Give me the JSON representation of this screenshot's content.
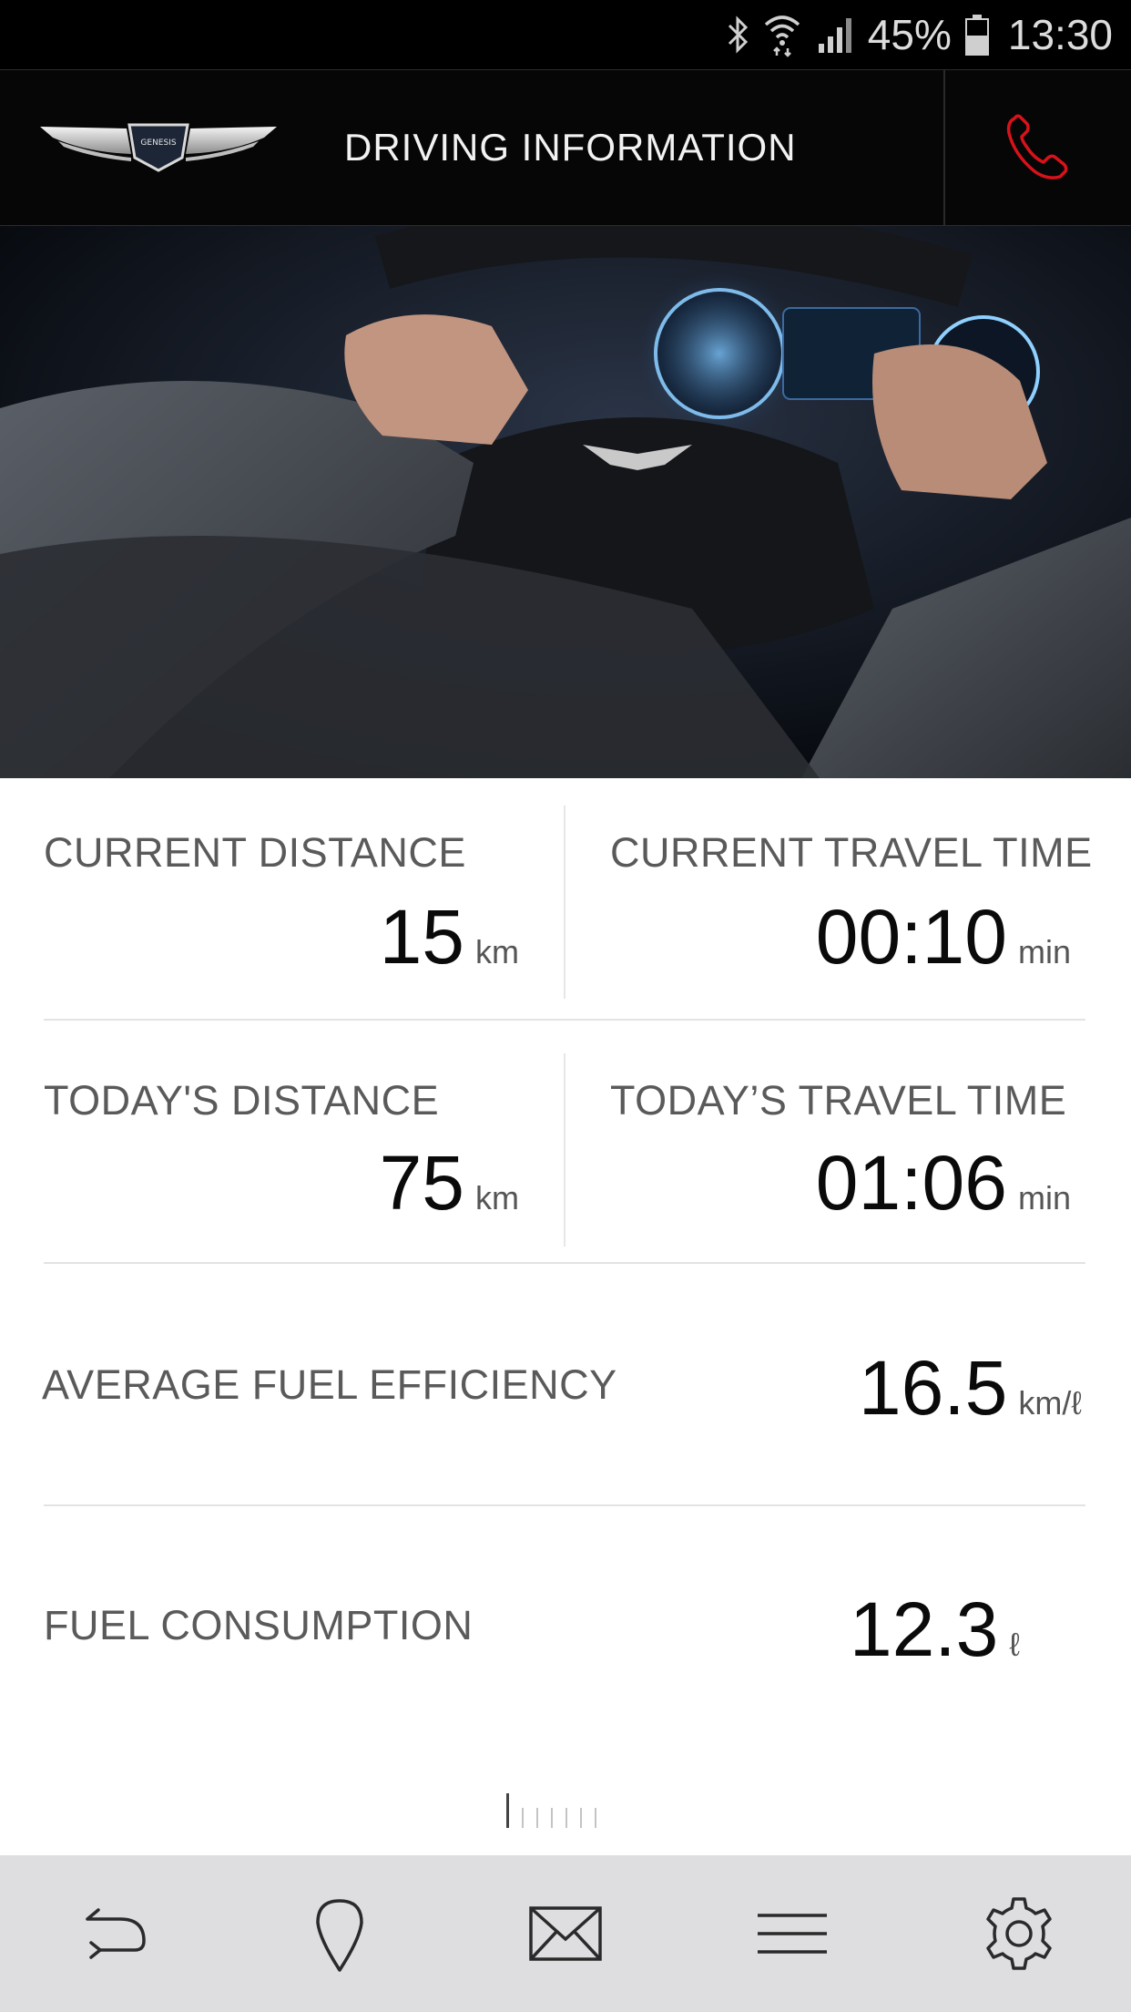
{
  "status_bar": {
    "battery_percent": "45%",
    "time": "13:30",
    "icons": [
      "bluetooth-icon",
      "wifi-icon",
      "signal-icon",
      "battery-icon"
    ]
  },
  "header": {
    "logo_text": "GENESIS",
    "title": "DRIVING INFORMATION",
    "call_icon": "phone-icon",
    "accent_color": "#d8121b"
  },
  "stats": {
    "current_distance": {
      "label": "CURRENT DISTANCE",
      "value": "15",
      "unit": "km"
    },
    "current_travel_time": {
      "label": "CURRENT TRAVEL TIME",
      "value": "00:10",
      "unit": "min"
    },
    "todays_distance": {
      "label": "TODAY'S DISTANCE",
      "value": "75",
      "unit": "km"
    },
    "todays_travel_time": {
      "label": "TODAY’S TRAVEL TIME",
      "value": "01:06",
      "unit": "min"
    },
    "average_fuel_efficiency": {
      "label": "AVERAGE FUEL EFFICIENCY",
      "value": "16.5",
      "unit": "km/ℓ"
    },
    "fuel_consumption": {
      "label": "FUEL CONSUMPTION",
      "value": "12.3",
      "unit": "ℓ"
    }
  },
  "pager": {
    "total": 7,
    "active": 1
  },
  "bottom_nav": [
    "back-icon",
    "location-pin-icon",
    "mail-icon",
    "menu-icon",
    "settings-icon"
  ]
}
